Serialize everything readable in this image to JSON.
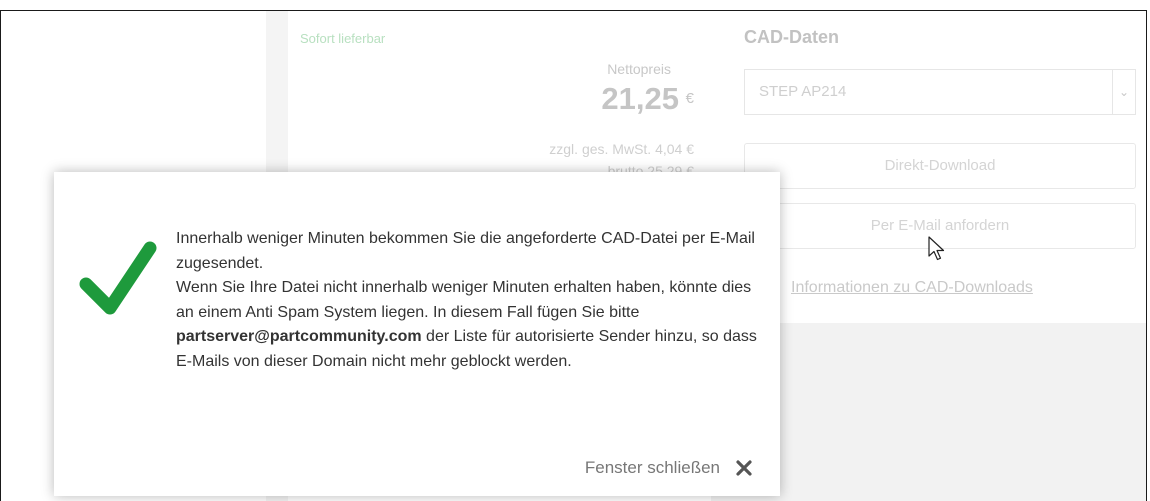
{
  "background_page": {
    "availability": "Sofort lieferbar",
    "net_price_label": "Nettopreis",
    "price": "21,25",
    "currency": "€",
    "vat_line": "zzgl. ges. MwSt. 4,04 €",
    "gross_line": "brutto 25,29 €",
    "cad_title": "CAD-Daten",
    "cad_format": "STEP AP214",
    "direct_download_label": "Direkt-Download",
    "email_request_label": "Per E-Mail anfordern",
    "cad_info_link": "Informationen zu CAD-Downloads"
  },
  "modal": {
    "line1": "Innerhalb weniger Minuten bekommen Sie die angeforderte CAD-Datei per E-Mail zugesendet.",
    "line2_prefix": "Wenn Sie Ihre Datei nicht innerhalb weniger Minuten erhalten haben, könnte dies an einem Anti Spam System liegen. In diesem Fall fügen Sie bitte ",
    "email": "partserver@partcommunity.com",
    "line2_suffix": " der Liste für autorisierte Sender hinzu, so dass E-Mails von dieser Domain nicht mehr geblockt werden.",
    "close_label": "Fenster schließen",
    "success_icon": "checkmark-icon",
    "close_icon": "close-icon"
  },
  "colors": {
    "check_green": "#1e9a3c",
    "close_x": "#555555"
  }
}
